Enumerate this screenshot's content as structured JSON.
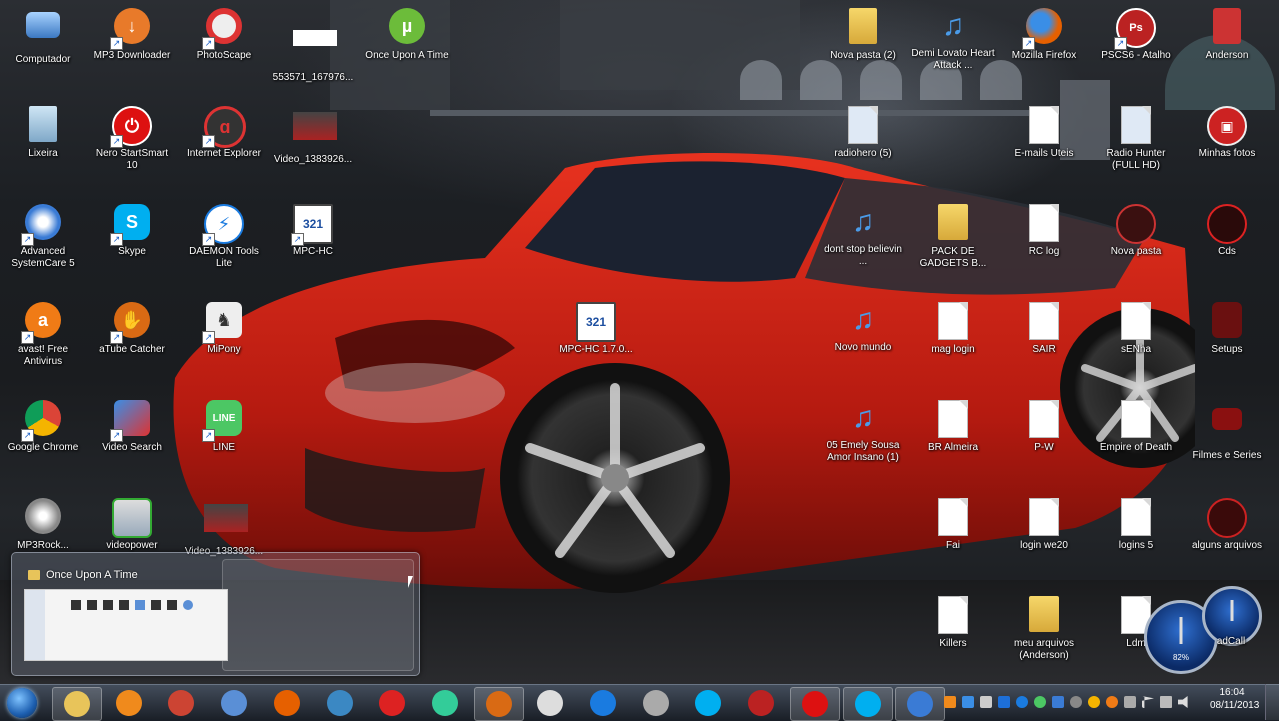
{
  "desktop": {
    "icons": [
      {
        "id": "computador",
        "label": "Computador"
      },
      {
        "id": "mp3-downloader",
        "label": "MP3 Downloader"
      },
      {
        "id": "photoscape",
        "label": "PhotoScape"
      },
      {
        "id": "file-553571",
        "label": "553571_167976..."
      },
      {
        "id": "once-upon-a-time",
        "label": "Once Upon A Time"
      },
      {
        "id": "lixeira",
        "label": "Lixeira"
      },
      {
        "id": "nero",
        "label": "Nero StartSmart 10"
      },
      {
        "id": "internet-explorer",
        "label": "Internet Explorer"
      },
      {
        "id": "video-1383926",
        "label": "Video_1383926..."
      },
      {
        "id": "advanced-systemcare",
        "label": "Advanced SystemCare 5"
      },
      {
        "id": "skype",
        "label": "Skype"
      },
      {
        "id": "daemon-tools",
        "label": "DAEMON Tools Lite"
      },
      {
        "id": "mpc-hc",
        "label": "MPC-HC"
      },
      {
        "id": "avast",
        "label": "avast! Free Antivirus"
      },
      {
        "id": "atube-catcher",
        "label": "aTube Catcher"
      },
      {
        "id": "mipony",
        "label": "MiPony"
      },
      {
        "id": "mpc-hc-17",
        "label": "MPC-HC 1.7.0..."
      },
      {
        "id": "google-chrome",
        "label": "Google Chrome"
      },
      {
        "id": "video-search",
        "label": "Video Search"
      },
      {
        "id": "line",
        "label": "LINE"
      },
      {
        "id": "mp3-rocket",
        "label": "MP3Rock..."
      },
      {
        "id": "videopower",
        "label": "videopower"
      },
      {
        "id": "video-1383926b",
        "label": "Video_1383926..."
      },
      {
        "id": "nova-pasta-2",
        "label": "Nova pasta (2)"
      },
      {
        "id": "demi-lovato",
        "label": "Demi Lovato Heart Attack ..."
      },
      {
        "id": "mozilla-firefox",
        "label": "Mozilla Firefox"
      },
      {
        "id": "pscs6",
        "label": "PSCS6 - Atalho"
      },
      {
        "id": "anderson",
        "label": "Anderson"
      },
      {
        "id": "radiohero",
        "label": "radiohero (5)"
      },
      {
        "id": "emails-uteis",
        "label": "E-mails Uteis"
      },
      {
        "id": "radio-hunter",
        "label": "Radio Hunter (FULL HD)"
      },
      {
        "id": "minhas-fotos",
        "label": "Minhas fotos"
      },
      {
        "id": "dont-stop-believin",
        "label": "dont stop believin ..."
      },
      {
        "id": "pack-de-gadgets",
        "label": "PACK DE GADGETS B..."
      },
      {
        "id": "rc-log",
        "label": "RC log"
      },
      {
        "id": "nova-pasta",
        "label": "Nova pasta"
      },
      {
        "id": "cds",
        "label": "Cds"
      },
      {
        "id": "novo-mundo",
        "label": "Novo mundo"
      },
      {
        "id": "mag-login",
        "label": "mag login"
      },
      {
        "id": "sair",
        "label": "SAIR"
      },
      {
        "id": "senha",
        "label": "sENha"
      },
      {
        "id": "setups",
        "label": "Setups"
      },
      {
        "id": "emely-sousa",
        "label": "05 Emely Sousa Amor Insano (1)"
      },
      {
        "id": "br-almeira",
        "label": "BR Almeira"
      },
      {
        "id": "p-w",
        "label": "P-W"
      },
      {
        "id": "empire-of-death",
        "label": "Empire of Death"
      },
      {
        "id": "filmes-e-series",
        "label": "Filmes e Series"
      },
      {
        "id": "fai",
        "label": "Fai"
      },
      {
        "id": "login-we20",
        "label": "login we20"
      },
      {
        "id": "logins",
        "label": "logins 5"
      },
      {
        "id": "alguns-arquivos",
        "label": "alguns arquivos"
      },
      {
        "id": "killers",
        "label": "Killers"
      },
      {
        "id": "meu-arquivos",
        "label": "meu arquivos (Anderson)"
      },
      {
        "id": "ldm",
        "label": "Ldm"
      },
      {
        "id": "adcall",
        "label": "adCall"
      }
    ]
  },
  "preview": {
    "title": "Once Upon A Time"
  },
  "gadget": {
    "label": "82%"
  },
  "taskbar": {
    "items": [
      {
        "name": "explorer-task-button",
        "icon": "folder-icon",
        "color": "#e8c45a",
        "active": true
      },
      {
        "name": "media-player-task-button",
        "icon": "media-player-icon",
        "color": "#f08a1c"
      },
      {
        "name": "cleaner-task-button",
        "icon": "cleaner-icon",
        "color": "#c43"
      },
      {
        "name": "notepad-task-button",
        "icon": "notepad-icon",
        "color": "#5a8fd6"
      },
      {
        "name": "firefox-task-button",
        "icon": "firefox-icon",
        "color": "#e66000"
      },
      {
        "name": "picture-viewer-task-button",
        "icon": "picture-viewer-icon",
        "color": "#3b88c3"
      },
      {
        "name": "nero-task-button",
        "icon": "nero-icon",
        "color": "#d22"
      },
      {
        "name": "chrome-task-button",
        "icon": "chrome-icon",
        "color": "#3c9"
      },
      {
        "name": "atube-task-button",
        "icon": "atube-icon",
        "color": "#d96a14",
        "active": true
      },
      {
        "name": "mipony-task-button",
        "icon": "mipony-icon",
        "color": "#ddd"
      },
      {
        "name": "daemon-tools-task-button",
        "icon": "daemon-tools-icon",
        "color": "#1a7be0"
      },
      {
        "name": "webcam-task-button",
        "icon": "webcam-icon",
        "color": "#aaa"
      },
      {
        "name": "skype-task-button",
        "icon": "skype-icon",
        "color": "#00aff0"
      },
      {
        "name": "pscs6-task-button",
        "icon": "pscs6-icon",
        "color": "#b22"
      },
      {
        "name": "opera-task-button",
        "icon": "opera-icon",
        "color": "#d11",
        "active": true
      },
      {
        "name": "skype-2-task-button",
        "icon": "skype-icon",
        "color": "#00aff0",
        "active": true
      },
      {
        "name": "advanced-systemcare-task-button",
        "icon": "systemcare-icon",
        "color": "#3a7bd5",
        "active": true
      }
    ],
    "clock_time": "16:04",
    "clock_date": "08/11/2013"
  }
}
